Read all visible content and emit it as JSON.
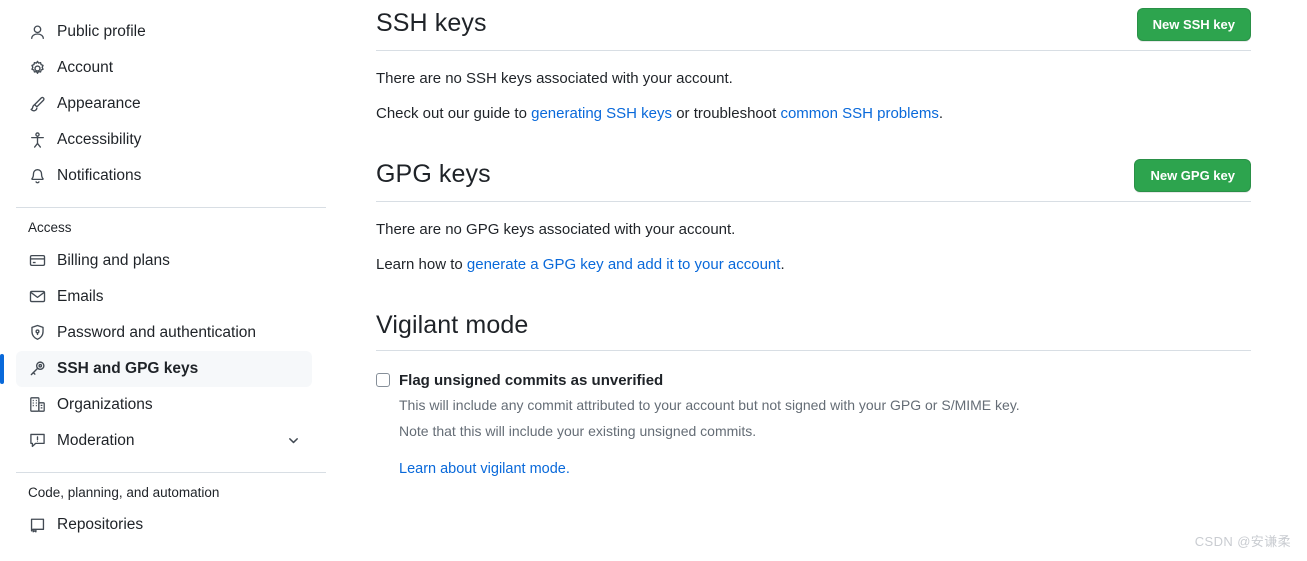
{
  "sidebar": {
    "groups": [
      {
        "heading": null,
        "items": [
          {
            "label": "Public profile",
            "icon": "person-icon",
            "selected": false,
            "chevron": false
          },
          {
            "label": "Account",
            "icon": "gear-icon",
            "selected": false,
            "chevron": false
          },
          {
            "label": "Appearance",
            "icon": "paintbrush-icon",
            "selected": false,
            "chevron": false
          },
          {
            "label": "Accessibility",
            "icon": "accessibility-icon",
            "selected": false,
            "chevron": false
          },
          {
            "label": "Notifications",
            "icon": "bell-icon",
            "selected": false,
            "chevron": false
          }
        ]
      },
      {
        "heading": "Access",
        "items": [
          {
            "label": "Billing and plans",
            "icon": "credit-card-icon",
            "selected": false,
            "chevron": false
          },
          {
            "label": "Emails",
            "icon": "mail-icon",
            "selected": false,
            "chevron": false
          },
          {
            "label": "Password and authentication",
            "icon": "shield-lock-icon",
            "selected": false,
            "chevron": false
          },
          {
            "label": "SSH and GPG keys",
            "icon": "key-icon",
            "selected": true,
            "chevron": false
          },
          {
            "label": "Organizations",
            "icon": "organization-icon",
            "selected": false,
            "chevron": false
          },
          {
            "label": "Moderation",
            "icon": "report-icon",
            "selected": false,
            "chevron": true
          }
        ]
      },
      {
        "heading": "Code, planning, and automation",
        "items": [
          {
            "label": "Repositories",
            "icon": "repo-icon",
            "selected": false,
            "chevron": false
          }
        ]
      }
    ]
  },
  "main": {
    "ssh": {
      "title": "SSH keys",
      "button_label": "New SSH key",
      "empty_text": "There are no SSH keys associated with your account.",
      "help_prefix": "Check out our guide to ",
      "help_link_1": "generating SSH keys",
      "help_middle": " or troubleshoot ",
      "help_link_2": "common SSH problems",
      "help_suffix": "."
    },
    "gpg": {
      "title": "GPG keys",
      "button_label": "New GPG key",
      "empty_text": "There are no GPG keys associated with your account.",
      "help_prefix": "Learn how to ",
      "help_link_1": "generate a GPG key and add it to your account",
      "help_suffix": "."
    },
    "vigilant": {
      "title": "Vigilant mode",
      "checkbox_label": "Flag unsigned commits as unverified",
      "checkbox_checked": false,
      "note_line_1": "This will include any commit attributed to your account but not signed with your GPG or S/MIME key.",
      "note_line_2": "Note that this will include your existing unsigned commits.",
      "learn_link": "Learn about vigilant mode."
    }
  },
  "watermark": {
    "text": "CSDN @安谦柔"
  },
  "colors": {
    "accent_blue": "#0969da",
    "success_green": "#2da44e",
    "text_primary": "#1f2328",
    "text_muted": "#656d76",
    "border": "#d8dee4",
    "selected_bg": "#f6f8fa"
  }
}
